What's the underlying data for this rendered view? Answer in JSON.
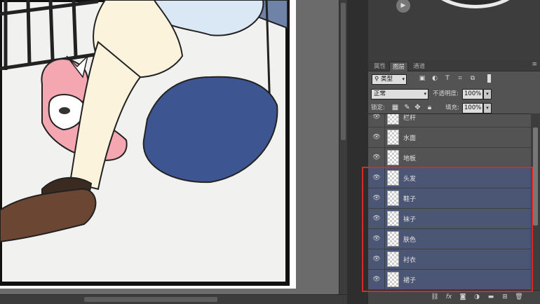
{
  "panel": {
    "tabs": [
      "属性",
      "图层",
      "通道"
    ],
    "active_tab": "图层",
    "menu_icon": "panel-menu-icon",
    "filter": {
      "kind_label": "类型"
    },
    "blend_mode": "正常",
    "opacity_label": "不透明度:",
    "opacity_value": "100%",
    "lock_label": "锁定:",
    "fill_label": "填充:",
    "fill_value": "100%"
  },
  "layers": [
    {
      "name": "栏杆",
      "selected": false
    },
    {
      "name": "水面",
      "selected": false
    },
    {
      "name": "地板",
      "selected": false
    },
    {
      "name": "头发",
      "selected": true
    },
    {
      "name": "鞋子",
      "selected": true
    },
    {
      "name": "袜子",
      "selected": true
    },
    {
      "name": "肤色",
      "selected": true
    },
    {
      "name": "衬衣",
      "selected": true
    },
    {
      "name": "裙子",
      "selected": true
    }
  ],
  "bottom_icons": [
    "link-icon",
    "fx-icon",
    "mask-icon",
    "adjustment-icon",
    "folder-icon",
    "new-layer-icon",
    "trash-icon"
  ],
  "colors": {
    "highlight": "#d42a2a",
    "selected_row": "#4b5674",
    "panel_bg": "#535353"
  }
}
